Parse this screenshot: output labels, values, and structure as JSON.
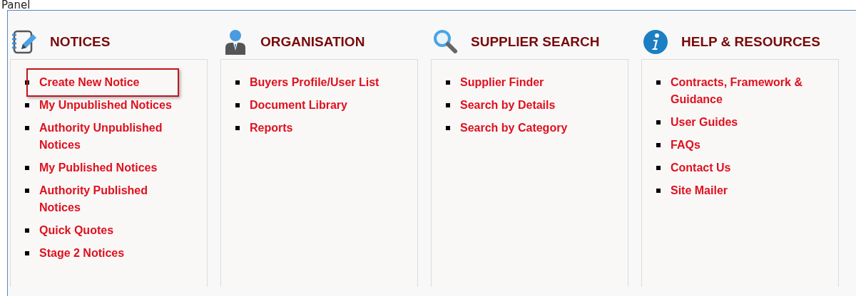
{
  "page_title": "Panel",
  "columns": [
    {
      "kind": "notices",
      "title": "NOTICES",
      "items": [
        {
          "label": "Create New Notice",
          "highlighted": true
        },
        {
          "label": "My Unpublished Notices",
          "highlighted": false
        },
        {
          "label": "Authority Unpublished Notices",
          "highlighted": false
        },
        {
          "label": "My Published Notices",
          "highlighted": false
        },
        {
          "label": "Authority Published Notices",
          "highlighted": false
        },
        {
          "label": "Quick Quotes",
          "highlighted": false
        },
        {
          "label": "Stage 2 Notices",
          "highlighted": false
        }
      ]
    },
    {
      "kind": "organisation",
      "title": "ORGANISATION",
      "items": [
        {
          "label": "Buyers Profile/User List",
          "highlighted": false
        },
        {
          "label": "Document Library",
          "highlighted": false
        },
        {
          "label": "Reports",
          "highlighted": false
        }
      ]
    },
    {
      "kind": "search",
      "title": "SUPPLIER SEARCH",
      "items": [
        {
          "label": "Supplier Finder",
          "highlighted": false
        },
        {
          "label": "Search by Details",
          "highlighted": false
        },
        {
          "label": "Search by Category",
          "highlighted": false
        }
      ]
    },
    {
      "kind": "help",
      "title": "HELP & RESOURCES",
      "items": [
        {
          "label": "Contracts, Framework & Guidance",
          "highlighted": false
        },
        {
          "label": "User Guides",
          "highlighted": false
        },
        {
          "label": "FAQs",
          "highlighted": false
        },
        {
          "label": "Contact Us",
          "highlighted": false
        },
        {
          "label": "Site Mailer",
          "highlighted": false
        }
      ]
    }
  ]
}
